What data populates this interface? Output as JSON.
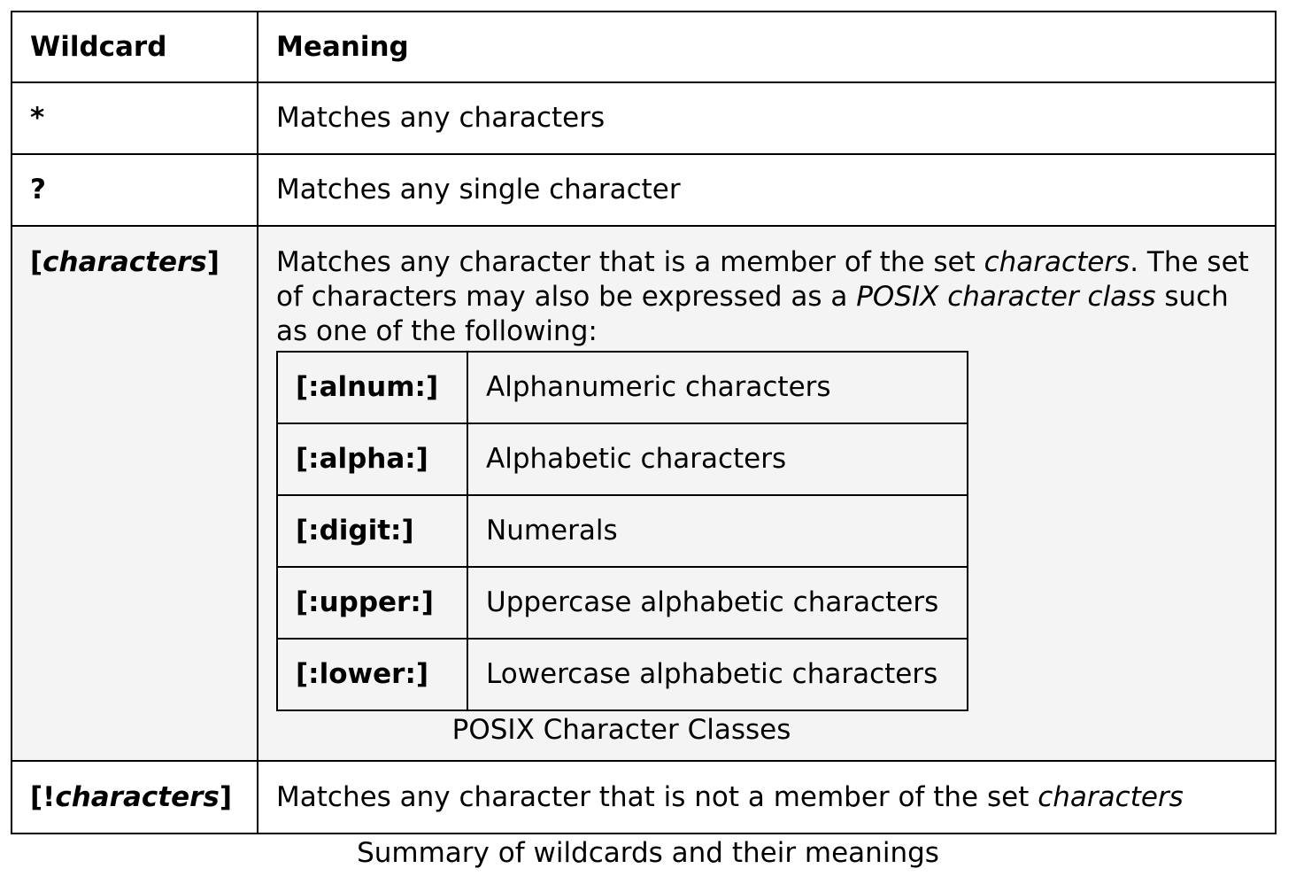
{
  "header": {
    "wildcard": "Wildcard",
    "meaning": "Meaning"
  },
  "rows": {
    "star": {
      "wildcard": "*",
      "meaning": "Matches any characters"
    },
    "question": {
      "wildcard": "?",
      "meaning": "Matches any single character"
    },
    "charset": {
      "wildcard_open": "[",
      "wildcard_italic": "characters",
      "wildcard_close": "]",
      "meaning_part1": "Matches any character that is a member of the set ",
      "meaning_italic1": "characters",
      "meaning_part2": ". The set of characters may also be expressed as a ",
      "meaning_italic2": "POSIX character class",
      "meaning_part3": " such as one of the following:"
    },
    "notset": {
      "wildcard_open": "[!",
      "wildcard_italic": "characters",
      "wildcard_close": "]",
      "meaning_part1": "Matches any character that is not a member of the set ",
      "meaning_italic1": "characters"
    }
  },
  "posix_classes": [
    {
      "class": "[:alnum:]",
      "meaning": "Alphanumeric characters"
    },
    {
      "class": "[:alpha:]",
      "meaning": "Alphabetic characters"
    },
    {
      "class": "[:digit:]",
      "meaning": "Numerals"
    },
    {
      "class": "[:upper:]",
      "meaning": "Uppercase alphabetic characters"
    },
    {
      "class": "[:lower:]",
      "meaning": "Lowercase alphabetic characters"
    }
  ],
  "posix_caption": "POSIX Character Classes",
  "caption": "Summary of wildcards and their meanings"
}
